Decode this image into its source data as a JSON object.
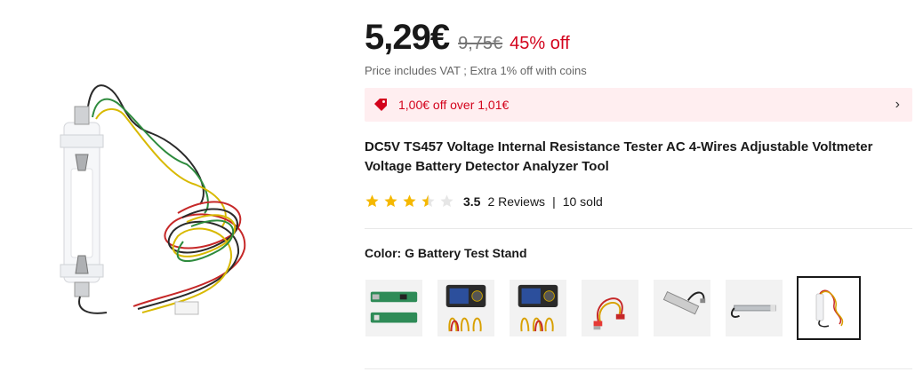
{
  "price": {
    "current": "5,29€",
    "original": "9,75€",
    "discount": "45% off",
    "note": "Price includes VAT ; Extra 1% off with coins"
  },
  "coupon": {
    "text": "1,00€ off over 1,01€",
    "icon": "tag-icon"
  },
  "product": {
    "title": "DC5V TS457 Voltage Internal Resistance Tester AC 4-Wires Adjustable Voltmeter Voltage Battery Detector Analyzer Tool"
  },
  "rating": {
    "value": "3.5",
    "stars": 3.5,
    "reviews": "2 Reviews",
    "separator": "|",
    "sold": "10 sold"
  },
  "color": {
    "label": "Color: G Battery Test Stand",
    "options": [
      "green-circuit-board",
      "tester-display-with-leads",
      "tester-display-with-leads-2",
      "alligator-clip-cable",
      "usb-cable-probe",
      "battery-holder-bar",
      "battery-test-stand"
    ],
    "selected_index": 6
  },
  "colors": {
    "accent": "#d3031c",
    "star": "#f5b800",
    "coupon_bg": "#ffeef0"
  }
}
